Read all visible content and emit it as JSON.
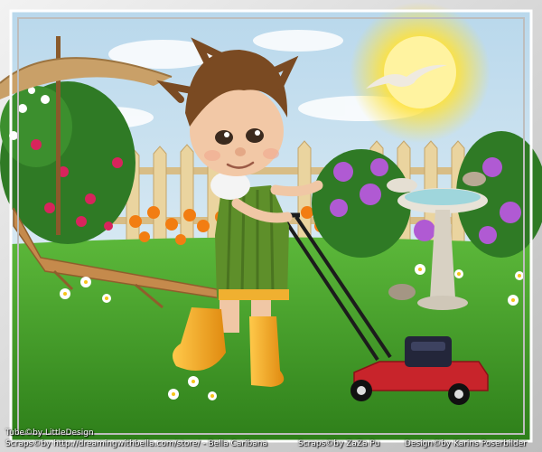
{
  "credits": {
    "tube": "Tube©by LittleDesign",
    "scraps_1": "Scraps©by http://dreamingwithbella.com/store/ - Bella Caribana",
    "scraps_2": "Scraps©by ZaZa Pu",
    "design": "Design©by Karins Poserbilder"
  },
  "colors": {
    "frame": "#d9d9d9",
    "sky": "#cfe4f2",
    "grass": "#3f9d25",
    "fence": "#e6cf9a",
    "sun": "#ffe23a",
    "boots": "#f4a51a",
    "overalls": "#5e8f2a",
    "mower": "#c8242b"
  }
}
